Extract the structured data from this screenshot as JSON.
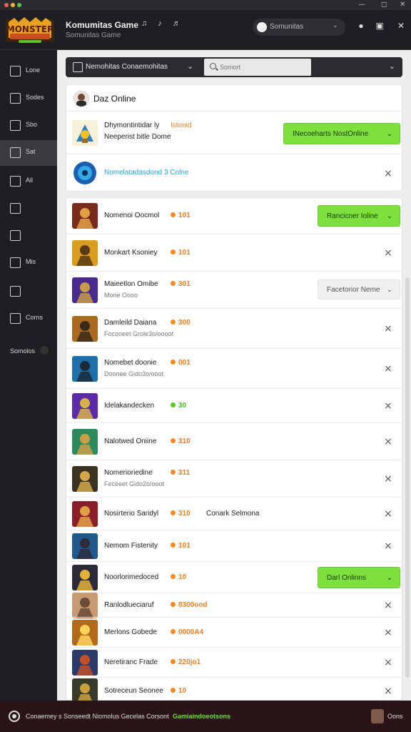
{
  "window": {
    "minimize": "—",
    "maximize": "◻",
    "close": "✕"
  },
  "header": {
    "logo_text": "MONSTER",
    "title": "Komumitas Game",
    "subtitle": "Somunitas Game",
    "icons_text": "♫ ♪ ♬",
    "user_label": "Somunitas",
    "user_chevron": "⌄",
    "bell": "●",
    "grid": "▣",
    "close": "✕"
  },
  "sidebar": {
    "items": [
      {
        "label": "Lone",
        "icon": "home-icon"
      },
      {
        "label": "Sodes",
        "icon": "stack-icon"
      },
      {
        "label": "Sbo",
        "icon": "shop-icon"
      },
      {
        "label": "Sat",
        "icon": "cursor-icon"
      },
      {
        "label": "All",
        "icon": "grid-icon"
      },
      {
        "label": "",
        "icon": "music-icon"
      },
      {
        "label": "",
        "icon": "tag-icon"
      },
      {
        "label": "Mis",
        "icon": "list-icon"
      },
      {
        "label": "",
        "icon": "gift-icon"
      },
      {
        "label": "Corns",
        "icon": "layers-icon"
      }
    ],
    "footer_label": "Somolos"
  },
  "filter": {
    "label": "Nemohitas Conaemohitas",
    "search_placeholder": "Somort"
  },
  "top_card": {
    "title": "Daz Online",
    "items": [
      {
        "title": "Dhymontintidar ly",
        "badge": "Istonid",
        "subtitle": "Neeperist bitle Dome",
        "button": "INecoeharts NostOnline",
        "button_type": "green"
      },
      {
        "title": "Nomelatadasdond 3 Colne",
        "title_color": "#1fa4d6",
        "button_type": "close"
      }
    ]
  },
  "list": [
    {
      "title": "Nomenoi Oocmol",
      "count": "101",
      "button": "Rancicner Ioline",
      "button_type": "green"
    },
    {
      "title": "Monkart Ksoniey",
      "count": "101",
      "button_type": "close"
    },
    {
      "title": "Maieetlon Omibe",
      "count": "301",
      "subtitle": "Mone Oooo",
      "button": "Facetorior Neme",
      "button_type": "grey"
    },
    {
      "title": "Damleild Daiana",
      "count": "300",
      "subtitle": "Foconeet Grole3o/oooot",
      "button_type": "close"
    },
    {
      "title": "Nomebet doonie",
      "count": "001",
      "subtitle": "Doonee Gido3o/ooot",
      "button_type": "close"
    },
    {
      "title": "Idelakandecken",
      "count": "30",
      "count_color": "green",
      "button_type": "close"
    },
    {
      "title": "Nalotwed Oniine",
      "count": "310",
      "button_type": "close"
    },
    {
      "title": "Nomerioriedine",
      "count": "311",
      "subtitle": "Feceeet Gido2o/ooot",
      "button_type": "close"
    },
    {
      "title": "Nosirterio Saridyl",
      "count": "310",
      "extra": "Conark Selmona",
      "button_type": "close"
    },
    {
      "title": "Nemom Fistenity",
      "count": "101",
      "button_type": "close"
    },
    {
      "title": "Noorlorimedoced",
      "count": "10",
      "button": "Darl Onlinns",
      "button_type": "green"
    },
    {
      "title": "Ranlodlueciaruf",
      "count": "8300ood",
      "button_type": "close"
    },
    {
      "title": "Merlons Gobede",
      "count": "0000A4",
      "button_type": "close"
    },
    {
      "title": "Neretiranc Frade",
      "count": "220jo1",
      "button_type": "close"
    },
    {
      "title": "Sotreceun Seonee",
      "count": "10",
      "button_type": "close"
    }
  ],
  "footer": {
    "text": "Conaemey s Sonseedt Niomolus Gecelas Corsont",
    "accent": "Gamiaindoeotsons",
    "user": "Oons"
  },
  "colors": {
    "accent_green": "#7ee03f",
    "count_orange": "#e0802c",
    "teal_title": "#1fa4d6"
  }
}
